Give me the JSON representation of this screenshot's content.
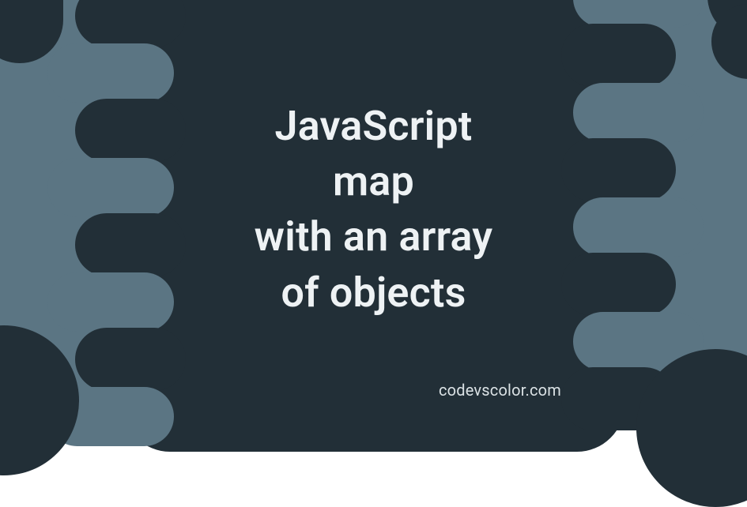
{
  "title_lines": {
    "l1": "JavaScript",
    "l2": "map",
    "l3": "with an array",
    "l4": "of objects"
  },
  "footer": "codevscolor.com",
  "colors": {
    "bg": "#5b7583",
    "dark": "#222f37",
    "text": "#eef2f4"
  }
}
